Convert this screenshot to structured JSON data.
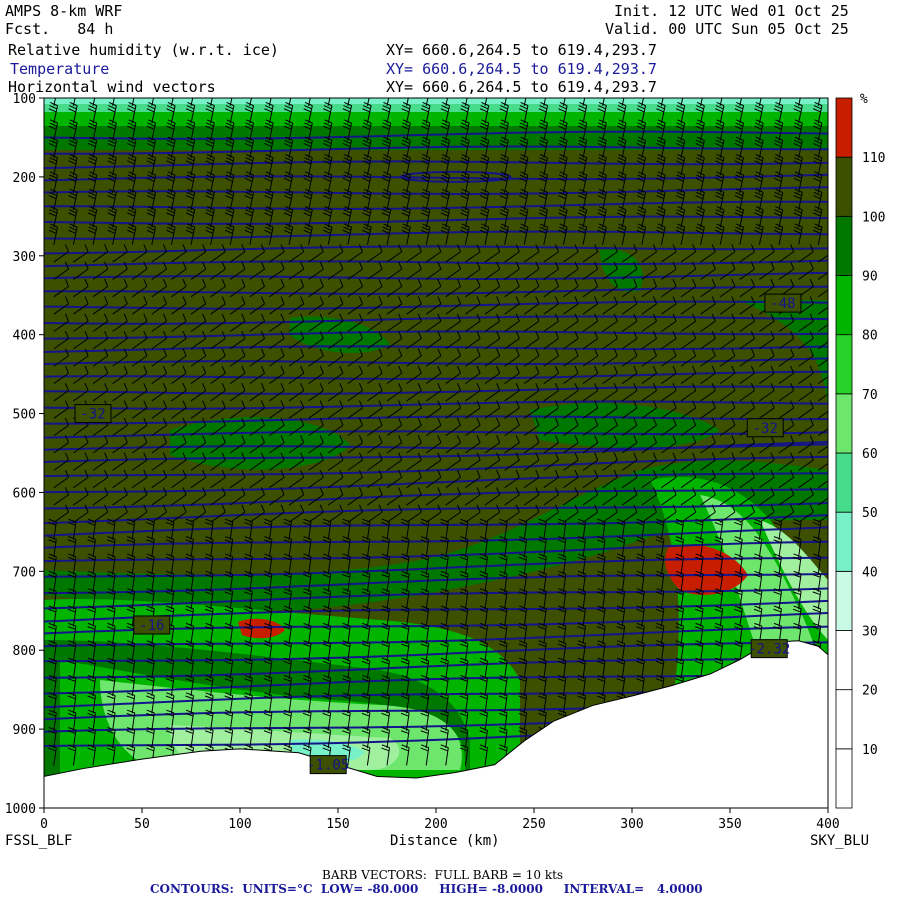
{
  "header": {
    "model": "AMPS 8-km WRF",
    "fcst": "Fcst.   84 h",
    "init": "Init. 12 UTC Wed 01 Oct 25",
    "valid": "Valid. 00 UTC Sun 05 Oct 25",
    "fields": [
      {
        "name": "Relative humidity (w.r.t. ice)",
        "coords": "XY= 660.6,264.5 to 619.4,293.7"
      },
      {
        "name": "Temperature",
        "coords": "XY= 660.6,264.5 to 619.4,293.7"
      },
      {
        "name": "Horizontal wind vectors",
        "coords": "XY= 660.6,264.5 to 619.4,293.7"
      }
    ]
  },
  "footer": {
    "barb": "BARB VECTORS:  FULL BARB = 10 kts",
    "contours": "CONTOURS:  UNITS=°C  LOW= -80.000     HIGH= -8.0000     INTERVAL=   4.0000"
  },
  "colors": {
    "olive": "#3c5000",
    "dark_green": "#007800",
    "green": "#00b400",
    "mid_green": "#28d228",
    "light_green": "#6ee66e",
    "red": "#c81e00",
    "contour": "#14148c"
  },
  "chart_data": {
    "type": "heatmap",
    "title": "Relative humidity (w.r.t. ice), Temperature, Horizontal wind vectors",
    "xlabel": "Distance (km)",
    "ylabel": "",
    "xlim": [
      0,
      400
    ],
    "ylim": [
      1000,
      100
    ],
    "x_ticks": [
      0,
      50,
      100,
      150,
      200,
      250,
      300,
      350,
      400
    ],
    "y_ticks": [
      100,
      200,
      300,
      400,
      500,
      600,
      700,
      800,
      900,
      1000
    ],
    "start_label": "FSSL_BLF",
    "end_label": "SKY_BLU",
    "colorbar": {
      "unit": "%",
      "levels": [
        10,
        20,
        30,
        40,
        50,
        60,
        70,
        80,
        90,
        100,
        110
      ],
      "colors": [
        "#ffffff",
        "#ffffff",
        "#ffffff",
        "#c8fae6",
        "#78f0c8",
        "#46dc8c",
        "#6ee66e",
        "#28d228",
        "#00b400",
        "#007800",
        "#3c5000",
        "#c81e00"
      ]
    },
    "terrain": [
      [
        0,
        960
      ],
      [
        20,
        950
      ],
      [
        50,
        938
      ],
      [
        80,
        928
      ],
      [
        100,
        925
      ],
      [
        130,
        930
      ],
      [
        150,
        945
      ],
      [
        170,
        960
      ],
      [
        190,
        962
      ],
      [
        210,
        955
      ],
      [
        230,
        945
      ],
      [
        245,
        915
      ],
      [
        260,
        890
      ],
      [
        280,
        870
      ],
      [
        300,
        858
      ],
      [
        320,
        845
      ],
      [
        340,
        830
      ],
      [
        355,
        812
      ],
      [
        370,
        790
      ],
      [
        385,
        788
      ],
      [
        395,
        795
      ],
      [
        402,
        810
      ]
    ],
    "contour_labels": [
      {
        "text": "-32",
        "x": 25,
        "p": 500
      },
      {
        "text": "-48",
        "x": 377,
        "p": 360
      },
      {
        "text": "-32",
        "x": 368,
        "p": 518
      },
      {
        "text": "-16",
        "x": 55,
        "p": 768
      },
      {
        "text": "-2.32",
        "x": 370,
        "p": 798
      },
      {
        "text": "-1.05",
        "x": 145,
        "p": 945
      }
    ]
  }
}
